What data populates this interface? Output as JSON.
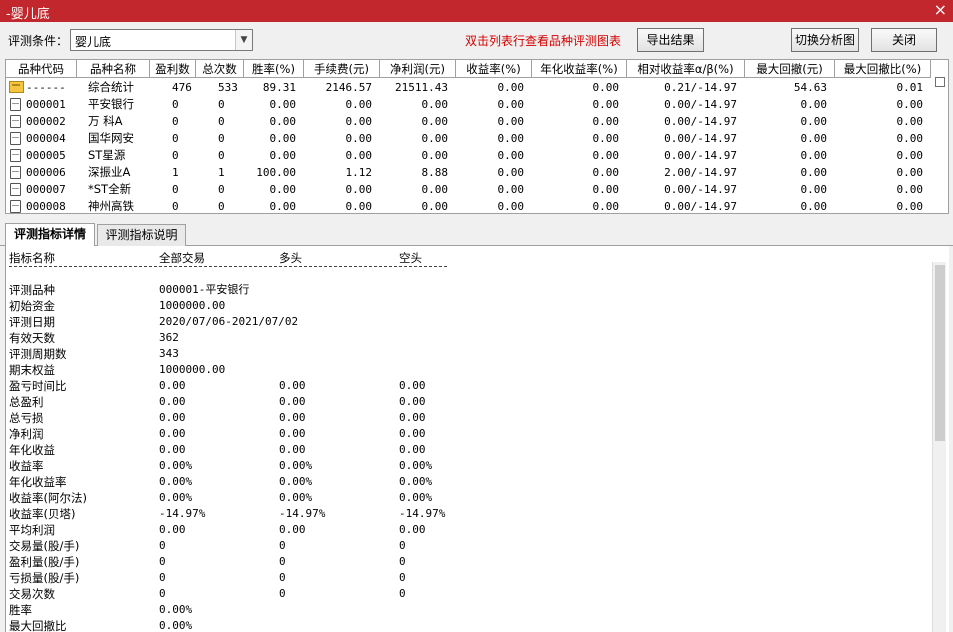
{
  "window": {
    "title": "-婴儿底",
    "close_glyph": "×"
  },
  "toolbar": {
    "condition_label": "评测条件：",
    "condition_value": "婴儿底",
    "hint": "双击列表行查看品种评测图表",
    "export_label": "导出结果",
    "switch_label": "切换分析图",
    "close_label": "关闭"
  },
  "grid": {
    "columns": [
      "品种代码",
      "品种名称",
      "盈利数",
      "总次数",
      "胜率(%)",
      "手续费(元)",
      "净利润(元)",
      "收益率(%)",
      "年化收益率(%)",
      "相对收益率α/β(%)",
      "最大回撤(元)",
      "最大回撤比(%)"
    ],
    "rows": [
      {
        "icon": "folder-icon",
        "code": "------",
        "name": "综合统计",
        "wins": "476",
        "total": "533",
        "winrate": "89.31",
        "fee": "2146.57",
        "net": "21511.43",
        "ret": "0.00",
        "annual": "0.00",
        "rel": "0.21/-14.97",
        "maxdd": "54.63",
        "ddratio": "0.01"
      },
      {
        "icon": "doc-icon",
        "code": "000001",
        "name": "平安银行",
        "wins": "0",
        "total": "0",
        "winrate": "0.00",
        "fee": "0.00",
        "net": "0.00",
        "ret": "0.00",
        "annual": "0.00",
        "rel": "0.00/-14.97",
        "maxdd": "0.00",
        "ddratio": "0.00"
      },
      {
        "icon": "doc-icon",
        "code": "000002",
        "name": "万 科A",
        "wins": "0",
        "total": "0",
        "winrate": "0.00",
        "fee": "0.00",
        "net": "0.00",
        "ret": "0.00",
        "annual": "0.00",
        "rel": "0.00/-14.97",
        "maxdd": "0.00",
        "ddratio": "0.00"
      },
      {
        "icon": "doc-icon",
        "code": "000004",
        "name": "国华网安",
        "wins": "0",
        "total": "0",
        "winrate": "0.00",
        "fee": "0.00",
        "net": "0.00",
        "ret": "0.00",
        "annual": "0.00",
        "rel": "0.00/-14.97",
        "maxdd": "0.00",
        "ddratio": "0.00"
      },
      {
        "icon": "doc-icon",
        "code": "000005",
        "name": "ST星源",
        "wins": "0",
        "total": "0",
        "winrate": "0.00",
        "fee": "0.00",
        "net": "0.00",
        "ret": "0.00",
        "annual": "0.00",
        "rel": "0.00/-14.97",
        "maxdd": "0.00",
        "ddratio": "0.00"
      },
      {
        "icon": "doc-icon",
        "code": "000006",
        "name": "深振业A",
        "wins": "1",
        "total": "1",
        "winrate": "100.00",
        "fee": "1.12",
        "net": "8.88",
        "ret": "0.00",
        "annual": "0.00",
        "rel": "2.00/-14.97",
        "maxdd": "0.00",
        "ddratio": "0.00"
      },
      {
        "icon": "doc-icon",
        "code": "000007",
        "name": "*ST全新",
        "wins": "0",
        "total": "0",
        "winrate": "0.00",
        "fee": "0.00",
        "net": "0.00",
        "ret": "0.00",
        "annual": "0.00",
        "rel": "0.00/-14.97",
        "maxdd": "0.00",
        "ddratio": "0.00"
      },
      {
        "icon": "doc-icon",
        "code": "000008",
        "name": "神州高铁",
        "wins": "0",
        "total": "0",
        "winrate": "0.00",
        "fee": "0.00",
        "net": "0.00",
        "ret": "0.00",
        "annual": "0.00",
        "rel": "0.00/-14.97",
        "maxdd": "0.00",
        "ddratio": "0.00"
      }
    ]
  },
  "tabs": [
    {
      "label": "评测指标详情",
      "active": true
    },
    {
      "label": "评测指标说明",
      "active": false
    }
  ],
  "detail": {
    "header": [
      "指标名称",
      "全部交易",
      "多头",
      "空头"
    ],
    "separator": "------------------------------------------------------------------------------------",
    "rows": [
      [
        "评测品种",
        "000001-平安银行",
        "",
        ""
      ],
      [
        "初始资金",
        "1000000.00",
        "",
        ""
      ],
      [
        "评测日期",
        "2020/07/06-2021/07/02",
        "",
        ""
      ],
      [
        "有效天数",
        "362",
        "",
        ""
      ],
      [
        "评测周期数",
        "343",
        "",
        ""
      ],
      [
        "期末权益",
        "1000000.00",
        "",
        ""
      ],
      [
        "盈亏时间比",
        "0.00",
        "0.00",
        "0.00"
      ],
      [
        "总盈利",
        "0.00",
        "0.00",
        "0.00"
      ],
      [
        "总亏损",
        "0.00",
        "0.00",
        "0.00"
      ],
      [
        "净利润",
        "0.00",
        "0.00",
        "0.00"
      ],
      [
        "年化收益",
        "0.00",
        "0.00",
        "0.00"
      ],
      [
        "收益率",
        "0.00%",
        "0.00%",
        "0.00%"
      ],
      [
        "年化收益率",
        "0.00%",
        "0.00%",
        "0.00%"
      ],
      [
        "收益率(阿尔法)",
        "0.00%",
        "0.00%",
        "0.00%"
      ],
      [
        "收益率(贝塔)",
        "-14.97%",
        "-14.97%",
        "-14.97%"
      ],
      [
        "平均利润",
        "0.00",
        "0.00",
        "0.00"
      ],
      [
        "交易量(股/手)",
        "0",
        "0",
        "0"
      ],
      [
        "盈利量(股/手)",
        "0",
        "0",
        "0"
      ],
      [
        "亏损量(股/手)",
        "0",
        "0",
        "0"
      ],
      [
        "交易次数",
        "0",
        "0",
        "0"
      ],
      [
        "胜率",
        "0.00%",
        "",
        ""
      ],
      [
        "最大回撤比",
        "0.00%",
        "",
        ""
      ]
    ]
  }
}
